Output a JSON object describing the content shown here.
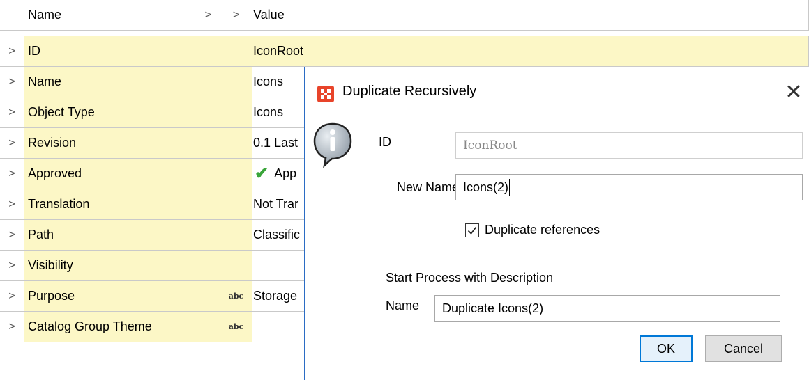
{
  "grid": {
    "header": {
      "name": "Name",
      "name_chevron": ">",
      "type_chevron": ">",
      "value": "Value"
    },
    "rows": [
      {
        "expander": ">",
        "name": "ID",
        "type": "",
        "value": "IconRoot"
      },
      {
        "expander": ">",
        "name": "Name",
        "type": "",
        "value": "Icons"
      },
      {
        "expander": ">",
        "name": "Object Type",
        "type": "",
        "value": "Icons"
      },
      {
        "expander": ">",
        "name": "Revision",
        "type": "",
        "value": "0.1 Last"
      },
      {
        "expander": ">",
        "name": "Approved",
        "type": "",
        "value": "App",
        "icon": "checkmark-icon"
      },
      {
        "expander": ">",
        "name": "Translation",
        "type": "",
        "value": "Not Trar"
      },
      {
        "expander": ">",
        "name": "Path",
        "type": "",
        "value": "Classific"
      },
      {
        "expander": ">",
        "name": "Visibility",
        "type": "",
        "value": ""
      },
      {
        "expander": ">",
        "name": "Purpose",
        "type": "abc",
        "value": "Storage"
      },
      {
        "expander": ">",
        "name": "Catalog Group Theme",
        "type": "abc",
        "value": ""
      }
    ]
  },
  "dialog": {
    "title": "Duplicate Recursively",
    "close": "✕",
    "id_label": "ID",
    "id_value": "IconRoot",
    "new_name_label": "New Name",
    "new_name_value": "Icons(2)",
    "duplicate_refs_label": "Duplicate references",
    "duplicate_refs_checked": true,
    "section_label": "Start Process with Description",
    "desc_name_label": "Name",
    "desc_name_value": "Duplicate Icons(2)",
    "ok_label": "OK",
    "cancel_label": "Cancel",
    "icons": [
      "app-logo-icon",
      "info-icon",
      "close-icon",
      "checkbox-check-icon"
    ]
  },
  "colors": {
    "row_highlight": "#fcf7c6",
    "dialog_border": "#2b6cc4",
    "app_icon": "#e8442a",
    "check_green": "#3aa53a",
    "ok_border": "#0078d7"
  }
}
